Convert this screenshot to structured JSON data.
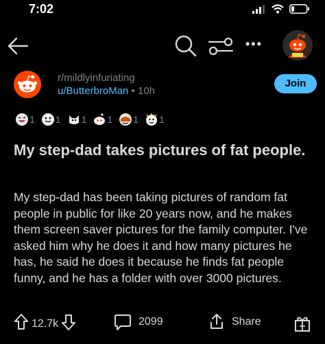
{
  "status": {
    "time": "7:02"
  },
  "post": {
    "subreddit": "r/mildlyinfuriating",
    "author": "u/ButterbroMan",
    "age": "10h",
    "join_label": "Join",
    "awards": [
      "1",
      "1",
      "1",
      "1",
      "1",
      "1"
    ],
    "title": "My step-dad takes pictures of fat people.",
    "body": "My step-dad has been taking pictures of random fat people in public for like 20 years now, and he makes them screen saver pictures for the family computer. I've asked him why he does it and how many pictures he has, he said he does it because he finds fat people funny, and he has a folder with over 3000 pictures."
  },
  "actions": {
    "votes": "12.7k",
    "comments": "2099",
    "share_label": "Share"
  },
  "colors": {
    "background": "#000000",
    "text": "#d7dadc",
    "muted": "#818384",
    "link": "#4fbcff",
    "join_bg": "#4fbcff",
    "reddit_orange": "#ff4500"
  }
}
